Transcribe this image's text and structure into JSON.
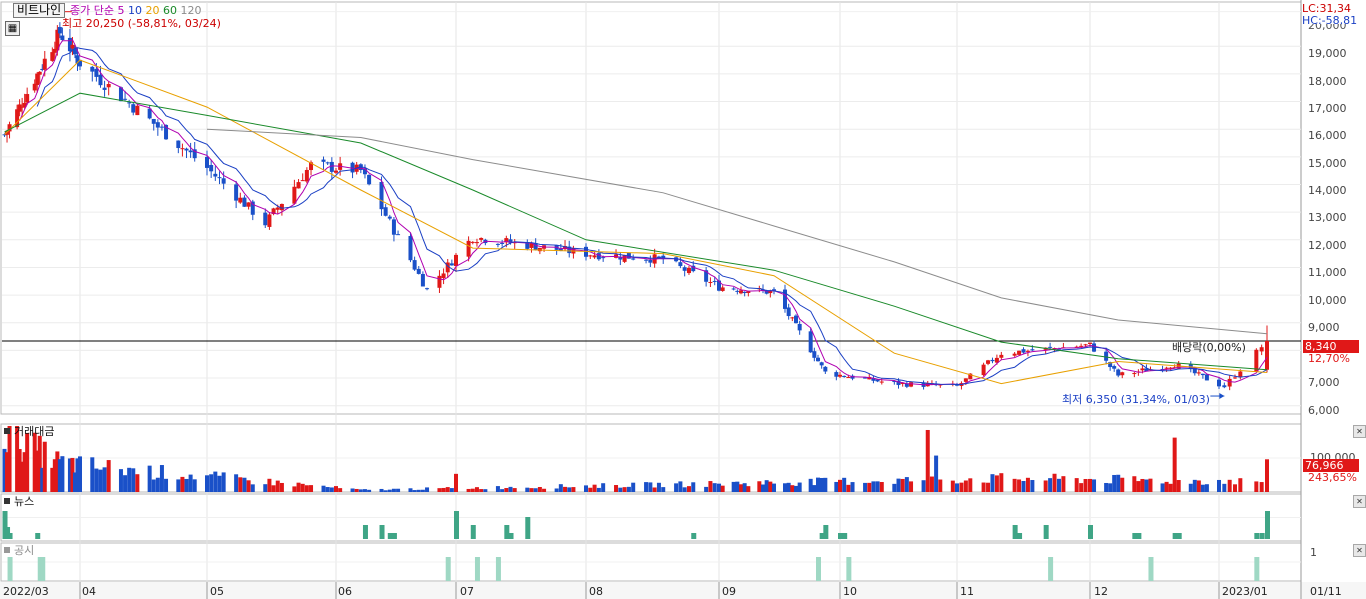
{
  "chart_data": {
    "type": "candlestick",
    "stock_name": "비트나인",
    "legend": {
      "prefix": "종가 단순",
      "periods": [
        "5",
        "10",
        "20",
        "60",
        "120"
      ],
      "colors": {
        "5": "#b000b0",
        "10": "#1a3fc4",
        "20": "#e8a000",
        "60": "#1a8a2a",
        "120": "#8c8c8c"
      }
    },
    "y_axis": {
      "ticks": [
        "19,000",
        "18,000",
        "17,000",
        "16,000",
        "15,000",
        "14,000",
        "13,000",
        "12,000",
        "11,000",
        "10,000",
        "9,000",
        "7,000",
        "6,000"
      ],
      "clipped_top_label": "20,000",
      "range": [
        5700,
        20600
      ]
    },
    "x_axis": {
      "labels": [
        "2022/03",
        "04",
        "05",
        "06",
        "07",
        "08",
        "09",
        "10",
        "11",
        "12",
        "2023/01",
        "01/11"
      ]
    },
    "annotations": {
      "high": "최고 20,250 (-58,81%, 03/24)",
      "low": "최저 6,350 (31,34%, 01/03)",
      "dividend": "배당락(0,00%)",
      "lc": "LC:31,34",
      "hc": "HC:-58,81",
      "current_price": "8,340",
      "current_pct": "12,70%"
    },
    "price_key_points": [
      {
        "date": "2022/03/02",
        "close": 15800
      },
      {
        "date": "2022/03/24",
        "close": 19500
      },
      {
        "date": "2022/04/01",
        "close": 18400
      },
      {
        "date": "2022/04/15",
        "close": 16700
      },
      {
        "date": "2022/05/02",
        "close": 14600
      },
      {
        "date": "2022/05/16",
        "close": 12600
      },
      {
        "date": "2022/05/27",
        "close": 14700
      },
      {
        "date": "2022/06/08",
        "close": 14500
      },
      {
        "date": "2022/06/24",
        "close": 10200
      },
      {
        "date": "2022/07/05",
        "close": 12100
      },
      {
        "date": "2022/08/01",
        "close": 11500
      },
      {
        "date": "2022/08/19",
        "close": 11300
      },
      {
        "date": "2022/09/01",
        "close": 10300
      },
      {
        "date": "2022/09/16",
        "close": 10100
      },
      {
        "date": "2022/09/30",
        "close": 7200
      },
      {
        "date": "2022/10/17",
        "close": 6800
      },
      {
        "date": "2022/11/01",
        "close": 6700
      },
      {
        "date": "2022/11/11",
        "close": 7900
      },
      {
        "date": "2022/12/01",
        "close": 8200
      },
      {
        "date": "2022/12/08",
        "close": 7100
      },
      {
        "date": "2022/12/22",
        "close": 7500
      },
      {
        "date": "2023/01/03",
        "close": 6700
      },
      {
        "date": "2023/01/11",
        "close": 8340
      }
    ],
    "moving_averages": [
      {
        "name": "20",
        "points": [
          {
            "date": "2022/03/02",
            "value": 15800
          },
          {
            "date": "2022/04/01",
            "value": 18500
          },
          {
            "date": "2022/05/02",
            "value": 16800
          },
          {
            "date": "2022/06/08",
            "value": 13800
          },
          {
            "date": "2022/07/05",
            "value": 11700
          },
          {
            "date": "2022/08/19",
            "value": 11500
          },
          {
            "date": "2022/09/16",
            "value": 10700
          },
          {
            "date": "2022/10/17",
            "value": 7900
          },
          {
            "date": "2022/11/11",
            "value": 6800
          },
          {
            "date": "2022/12/08",
            "value": 7600
          },
          {
            "date": "2023/01/11",
            "value": 7200
          }
        ]
      },
      {
        "name": "60",
        "points": [
          {
            "date": "2022/03/02",
            "value": 15900
          },
          {
            "date": "2022/04/01",
            "value": 17300
          },
          {
            "date": "2022/05/02",
            "value": 16500
          },
          {
            "date": "2022/06/08",
            "value": 15500
          },
          {
            "date": "2022/07/05",
            "value": 13800
          },
          {
            "date": "2022/08/01",
            "value": 12000
          },
          {
            "date": "2022/09/16",
            "value": 10900
          },
          {
            "date": "2022/10/17",
            "value": 9600
          },
          {
            "date": "2022/11/11",
            "value": 8300
          },
          {
            "date": "2022/12/08",
            "value": 7700
          },
          {
            "date": "2023/01/11",
            "value": 7300
          }
        ]
      },
      {
        "name": "120",
        "points": [
          {
            "date": "2022/05/02",
            "value": 16000
          },
          {
            "date": "2022/06/08",
            "value": 15700
          },
          {
            "date": "2022/07/05",
            "value": 14900
          },
          {
            "date": "2022/08/19",
            "value": 13700
          },
          {
            "date": "2022/09/16",
            "value": 12500
          },
          {
            "date": "2022/10/17",
            "value": 11200
          },
          {
            "date": "2022/11/11",
            "value": 9900
          },
          {
            "date": "2022/12/08",
            "value": 9100
          },
          {
            "date": "2023/01/11",
            "value": 8600
          }
        ]
      }
    ],
    "volume_panel": {
      "title": "거래대금",
      "tick": "100,000",
      "current": "76,966",
      "current_pct": "243,65%",
      "key_points": [
        {
          "date": "2022/03/02",
          "value": 140000
        },
        {
          "date": "2022/03/24",
          "value": 70000
        },
        {
          "date": "2022/06/08",
          "value": 5000
        },
        {
          "date": "2022/11/11",
          "value": 32000
        },
        {
          "date": "2022/12/01",
          "value": 30000
        },
        {
          "date": "2023/01/10",
          "value": 25000
        },
        {
          "date": "2023/01/11",
          "value": 76966
        }
      ]
    },
    "news_panel": {
      "title": "뉴스"
    },
    "disclosure_panel": {
      "title": "공시",
      "tick": "1"
    }
  }
}
